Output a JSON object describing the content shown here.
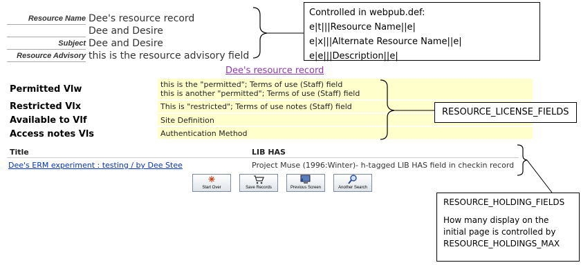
{
  "resource": {
    "rows": [
      {
        "label": "Resource Name",
        "value": "Dee's resource record"
      },
      {
        "label": "",
        "value": "Dee and Desire"
      },
      {
        "label": "Subject",
        "value": "Dee and Desire"
      },
      {
        "label": "Resource Advisory",
        "value": "this is the resource advisory field"
      }
    ]
  },
  "notes": {
    "webpub": {
      "lines": [
        "Controlled in webpub.def:",
        "e|t|||Resource Name||e|",
        "e|x|||Alternate Resource Name||e|",
        "e|e|||Description||e|"
      ]
    },
    "license_fields": "RESOURCE_LICENSE_FIELDS",
    "holding_fields": {
      "title": "RESOURCE_HOLDING_FIELDS",
      "lines": [
        "How many display on the",
        "initial page is controlled by",
        "RESOURCE_HOLDINGS_MAX"
      ]
    }
  },
  "record_link": "Dee's resource record",
  "license": {
    "rows": [
      {
        "label": "Permitted Vlw",
        "values": [
          "this is the \"permitted\"; Terms of use (Staff) field",
          "this is another \"permitted\"; Terms of use (Staff) field"
        ]
      },
      {
        "label": "Restricted Vlx",
        "values": [
          "This is \"restricted\"; Terms of use notes (Staff) field"
        ]
      },
      {
        "label": "Available to Vlf",
        "values": [
          "Site Definition"
        ]
      },
      {
        "label": "Access notes Vls",
        "values": [
          "Authentication Method"
        ]
      }
    ]
  },
  "holdings": {
    "headers": {
      "title": "Title",
      "lib_has": "LIB HAS"
    },
    "rows": [
      {
        "title": "Dee's ERM experiment : testing / by Dee Stee",
        "lib_has": "Project Muse (1996:Winter)- h-tagged LIB HAS field in checkin record"
      }
    ]
  },
  "buttons": [
    {
      "label": "Start Over",
      "icon": "asterisk-icon"
    },
    {
      "label": "Save Records",
      "icon": "cart-icon"
    },
    {
      "label": "Previous Screen",
      "icon": "monitor-icon"
    },
    {
      "label": "Another Search",
      "icon": "magnifier-icon"
    }
  ]
}
